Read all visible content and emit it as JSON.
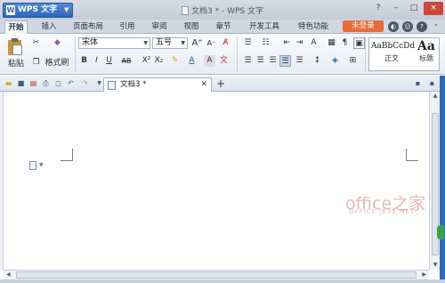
{
  "title_bar": {
    "app_menu_label": "WPS 文字",
    "app_logo": "W",
    "document_title": "文档3 * - WPS 文字",
    "window_buttons": [
      "?",
      "–",
      "□",
      "×"
    ]
  },
  "menu_tabs": [
    "开始",
    "插入",
    "页面布局",
    "引用",
    "审阅",
    "视图",
    "章节",
    "开发工具",
    "特色功能"
  ],
  "active_tab": "开始",
  "login_label": "未登录",
  "ribbon": {
    "paste_label": "粘贴",
    "format_painter_label": "格式刷",
    "font_name": "宋体",
    "font_size": "五号",
    "styles": [
      {
        "sample": "AaBbCcDd",
        "name": "正文"
      },
      {
        "sample": "Aa",
        "name": "标题"
      }
    ]
  },
  "doc_tabs": [
    {
      "title": "文档3 *"
    }
  ],
  "watermark": {
    "main": "office之家",
    "sub": "OFFICE.JB51.NET"
  },
  "colors": {
    "accent": "#2e67bd",
    "login": "#e86b38",
    "close": "#c9483a"
  }
}
